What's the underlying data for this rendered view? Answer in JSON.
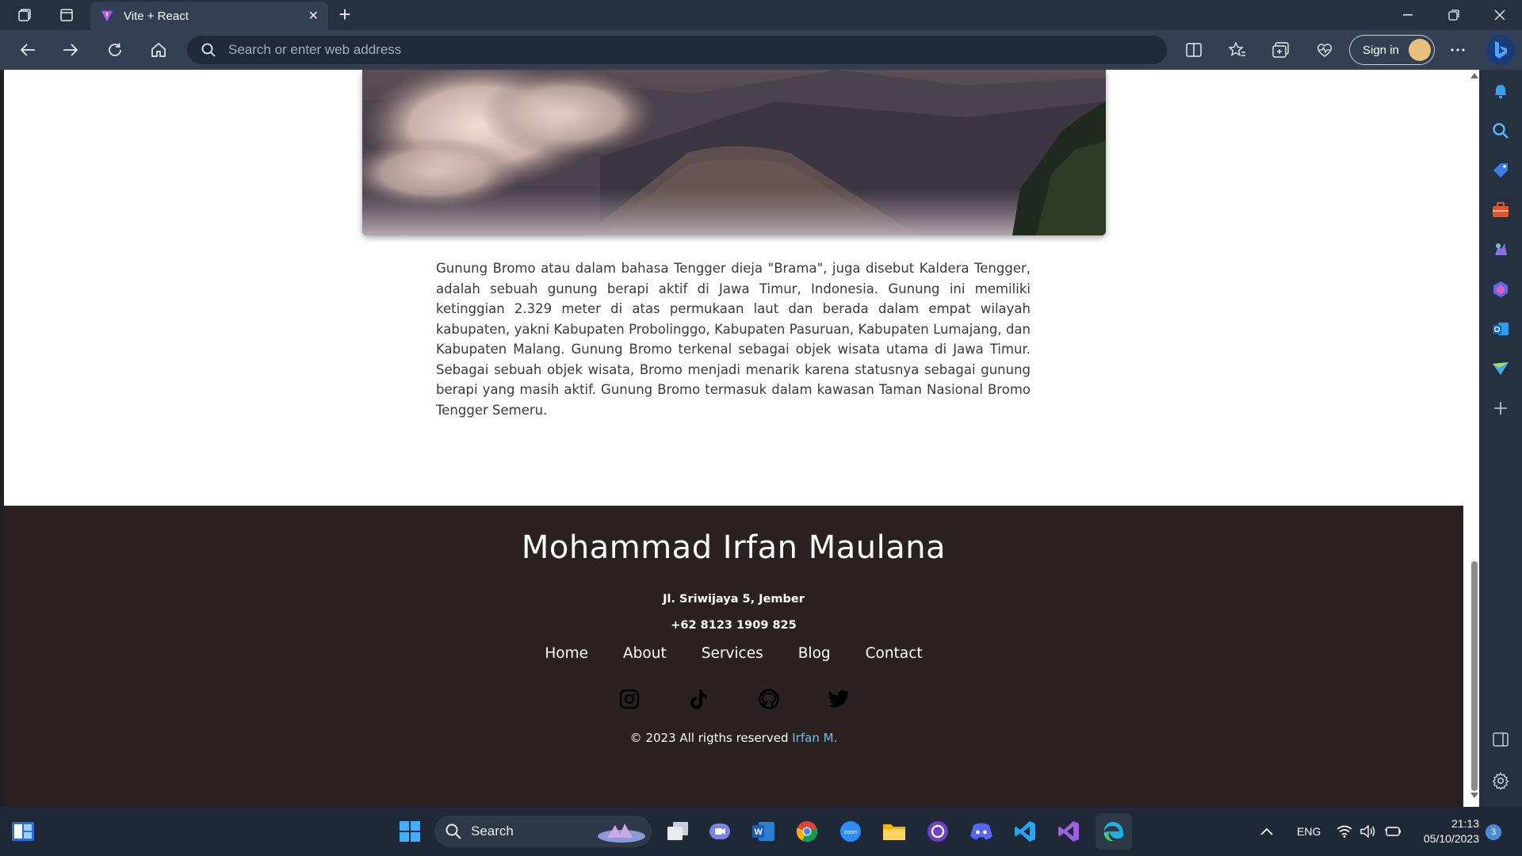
{
  "browser": {
    "tab_title": "Vite + React",
    "address_placeholder": "Search or enter web address",
    "sign_in_label": "Sign in"
  },
  "page": {
    "article_text": "Gunung Bromo atau dalam bahasa Tengger dieja \"Brama\", juga disebut Kaldera Tengger, adalah sebuah gunung berapi aktif di Jawa Timur, Indonesia. Gunung ini memiliki ketinggian 2.329 meter di atas permukaan laut dan berada dalam empat wilayah kabupaten, yakni Kabupaten Probolinggo, Kabupaten Pasuruan, Kabupaten Lumajang, dan Kabupaten Malang. Gunung Bromo terkenal sebagai objek wisata utama di Jawa Timur. Sebagai sebuah objek wisata, Bromo menjadi menarik karena statusnya sebagai gunung berapi yang masih aktif. Gunung Bromo termasuk dalam kawasan Taman Nasional Bromo Tengger Semeru.",
    "footer": {
      "name": "Mohammad Irfan Maulana",
      "address": "Jl. Sriwijaya 5, Jember",
      "phone": "+62 8123 1909 825",
      "nav": [
        "Home",
        "About",
        "Services",
        "Blog",
        "Contact"
      ],
      "social_icons": [
        "instagram-icon",
        "tiktok-icon",
        "github-icon",
        "twitter-icon"
      ],
      "copyright_prefix": "© 2023 All rigths reserved ",
      "copyright_link": "Irfan M."
    }
  },
  "taskbar": {
    "search_label": "Search",
    "language": "ENG",
    "time": "21:13",
    "date": "05/10/2023",
    "notification_count": "3"
  },
  "colors": {
    "footer_bg": "#2c2121",
    "link": "#6ec1e4",
    "chrome_bg": "#333f52"
  }
}
